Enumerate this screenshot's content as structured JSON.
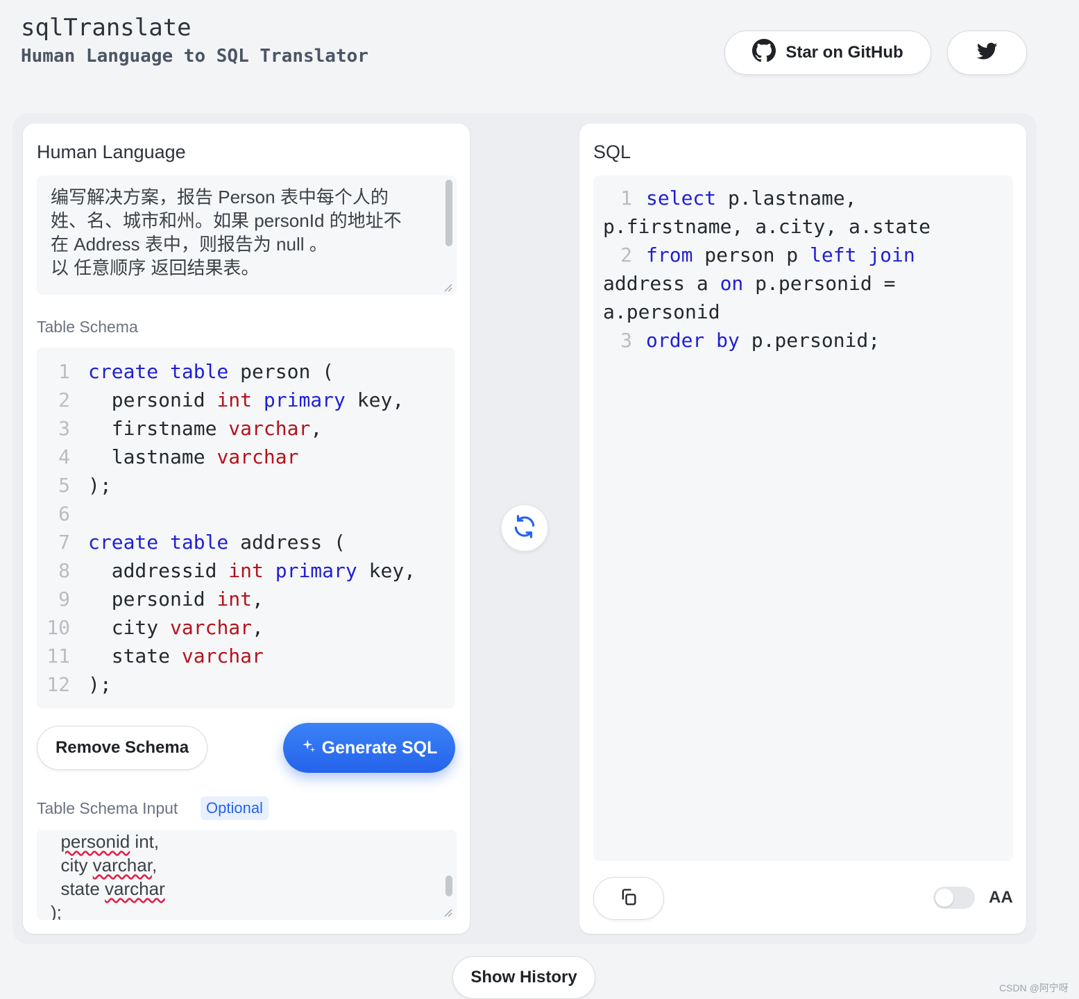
{
  "header": {
    "title": "sqlTranslate",
    "subtitle": "Human Language to SQL Translator",
    "github_label": "Star on GitHub"
  },
  "left_panel": {
    "heading": "Human Language",
    "human_text": [
      "编写解决方案，报告 Person 表中每个人的",
      "姓、名、城市和州。如果 personId 的地址不",
      "在 Address 表中，则报告为 null 。",
      "以 任意顺序 返回结果表。"
    ],
    "schema_label": "Table Schema",
    "schema_code": [
      {
        "n": "1",
        "tokens": [
          {
            "t": "create table",
            "c": "kw"
          },
          {
            "t": " person (",
            "c": ""
          }
        ]
      },
      {
        "n": "2",
        "tokens": [
          {
            "t": "  personid ",
            "c": ""
          },
          {
            "t": "int",
            "c": "ty"
          },
          {
            "t": " ",
            "c": ""
          },
          {
            "t": "primary",
            "c": "kw"
          },
          {
            "t": " key,",
            "c": ""
          }
        ]
      },
      {
        "n": "3",
        "tokens": [
          {
            "t": "  firstname ",
            "c": ""
          },
          {
            "t": "varchar",
            "c": "ty"
          },
          {
            "t": ",",
            "c": ""
          }
        ]
      },
      {
        "n": "4",
        "tokens": [
          {
            "t": "  lastname ",
            "c": ""
          },
          {
            "t": "varchar",
            "c": "ty"
          }
        ]
      },
      {
        "n": "5",
        "tokens": [
          {
            "t": ");",
            "c": ""
          }
        ]
      },
      {
        "n": "6",
        "tokens": []
      },
      {
        "n": "7",
        "tokens": [
          {
            "t": "create table",
            "c": "kw"
          },
          {
            "t": " address (",
            "c": ""
          }
        ]
      },
      {
        "n": "8",
        "tokens": [
          {
            "t": "  addressid ",
            "c": ""
          },
          {
            "t": "int",
            "c": "ty"
          },
          {
            "t": " ",
            "c": ""
          },
          {
            "t": "primary",
            "c": "kw"
          },
          {
            "t": " key,",
            "c": ""
          }
        ]
      },
      {
        "n": "9",
        "tokens": [
          {
            "t": "  personid ",
            "c": ""
          },
          {
            "t": "int",
            "c": "ty"
          },
          {
            "t": ",",
            "c": ""
          }
        ]
      },
      {
        "n": "10",
        "tokens": [
          {
            "t": "  city ",
            "c": ""
          },
          {
            "t": "varchar",
            "c": "ty"
          },
          {
            "t": ",",
            "c": ""
          }
        ]
      },
      {
        "n": "11",
        "tokens": [
          {
            "t": "  state ",
            "c": ""
          },
          {
            "t": "varchar",
            "c": "ty"
          }
        ]
      },
      {
        "n": "12",
        "tokens": [
          {
            "t": ");",
            "c": ""
          }
        ]
      }
    ],
    "remove_schema_label": "Remove Schema",
    "generate_label": "Generate SQL",
    "schema_input_label": "Table Schema Input",
    "optional_label": "Optional",
    "schema_input_lines": [
      {
        "pre": "  ",
        "word": "personid",
        "post": " int,"
      },
      {
        "pre": "  city ",
        "word": "varchar",
        "post": ","
      },
      {
        "pre": "  state ",
        "word": "varchar",
        "post": ""
      },
      {
        "pre": ");",
        "word": "",
        "post": ""
      }
    ]
  },
  "right_panel": {
    "heading": "SQL",
    "sql_lines": [
      {
        "n": "1",
        "tokens": [
          {
            "t": "select",
            "c": "kw"
          },
          {
            "t": " p.lastname, p.firstname, a.city, a.state",
            "c": ""
          }
        ]
      },
      {
        "n": "2",
        "tokens": [
          {
            "t": "from",
            "c": "kw"
          },
          {
            "t": " person p ",
            "c": ""
          },
          {
            "t": "left join",
            "c": "kw"
          },
          {
            "t": " address a ",
            "c": ""
          },
          {
            "t": "on",
            "c": "kw"
          },
          {
            "t": " p.personid = a.personid",
            "c": ""
          }
        ]
      },
      {
        "n": "3",
        "tokens": [
          {
            "t": "order by",
            "c": "kw"
          },
          {
            "t": " p.personid;",
            "c": ""
          }
        ]
      }
    ],
    "aa_label": "AA"
  },
  "footer": {
    "show_history_label": "Show History",
    "watermark": "CSDN @阿宁呀"
  },
  "colors": {
    "accent": "#2563eb",
    "keyword": "#1f1fd6",
    "type": "#b3131d",
    "background": "#f3f4f6"
  }
}
